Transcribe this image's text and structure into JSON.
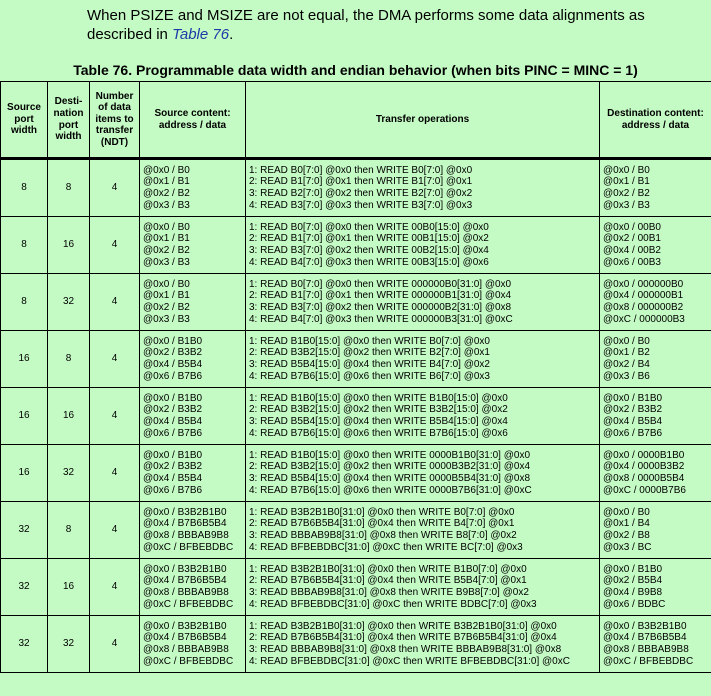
{
  "intro": {
    "text_before": "When PSIZE and MSIZE are not equal, the DMA performs some data alignments as described in ",
    "link": "Table 76",
    "text_after": "."
  },
  "table": {
    "caption": "Table 76. Programmable data width and endian behavior (when bits PINC = MINC = 1)",
    "headers": {
      "source_port": "Source port width",
      "dest_port": "Desti-nation port width",
      "ndt": "Number of data items to transfer (NDT)",
      "source_content": "Source content: address / data",
      "transfer": "Transfer operations",
      "dest_content": "Destination content: address / data"
    },
    "rows": [
      {
        "src_width": "8",
        "dst_width": "8",
        "ndt": "4",
        "src_content": "@0x0 / B0\n@0x1 / B1\n@0x2 / B2\n@0x3 / B3",
        "ops": "1: READ B0[7:0] @0x0 then WRITE B0[7:0] @0x0\n2: READ B1[7:0] @0x1 then WRITE B1[7:0] @0x1\n3: READ B2[7:0] @0x2 then WRITE B2[7:0] @0x2\n4: READ B3[7:0] @0x3 then WRITE B3[7:0] @0x3",
        "dst_content": "@0x0 / B0\n@0x1 / B1\n@0x2 / B2\n@0x3 / B3"
      },
      {
        "src_width": "8",
        "dst_width": "16",
        "ndt": "4",
        "src_content": "@0x0 / B0\n@0x1 / B1\n@0x2 / B2\n@0x3 / B3",
        "ops": "1: READ B0[7:0] @0x0 then WRITE 00B0[15:0] @0x0\n2: READ B1[7:0] @0x1 then WRITE 00B1[15:0] @0x2\n3: READ B3[7:0] @0x2 then WRITE 00B2[15:0] @0x4\n4: READ B4[7:0] @0x3 then WRITE 00B3[15:0] @0x6",
        "dst_content": "@0x0 / 00B0\n@0x2 / 00B1\n@0x4 / 00B2\n@0x6 / 00B3"
      },
      {
        "src_width": "8",
        "dst_width": "32",
        "ndt": "4",
        "src_content": "@0x0 / B0\n@0x1 / B1\n@0x2 / B2\n@0x3 / B3",
        "ops": "1: READ B0[7:0] @0x0 then WRITE 000000B0[31:0] @0x0\n2: READ B1[7:0] @0x1 then WRITE 000000B1[31:0] @0x4\n3: READ B3[7:0] @0x2 then WRITE 000000B2[31:0] @0x8\n4: READ B4[7:0] @0x3 then WRITE 000000B3[31:0] @0xC",
        "dst_content": "@0x0 / 000000B0\n@0x4 / 000000B1\n@0x8 / 000000B2\n@0xC / 000000B3"
      },
      {
        "src_width": "16",
        "dst_width": "8",
        "ndt": "4",
        "src_content": "@0x0 / B1B0\n@0x2 / B3B2\n@0x4 / B5B4\n@0x6 / B7B6",
        "ops": "1: READ B1B0[15:0] @0x0 then WRITE B0[7:0] @0x0\n2: READ B3B2[15:0] @0x2 then WRITE B2[7:0] @0x1\n3: READ B5B4[15:0] @0x4 then WRITE B4[7:0] @0x2\n4: READ B7B6[15:0] @0x6 then WRITE B6[7:0] @0x3",
        "dst_content": "@0x0 / B0\n@0x1 / B2\n@0x2 / B4\n@0x3 / B6"
      },
      {
        "src_width": "16",
        "dst_width": "16",
        "ndt": "4",
        "src_content": "@0x0 / B1B0\n@0x2 / B3B2\n@0x4 / B5B4\n@0x6 / B7B6",
        "ops": "1: READ B1B0[15:0] @0x0 then WRITE B1B0[15:0] @0x0\n2: READ B3B2[15:0] @0x2 then WRITE B3B2[15:0] @0x2\n3: READ B5B4[15:0] @0x4 then WRITE B5B4[15:0] @0x4\n4: READ B7B6[15:0] @0x6 then WRITE B7B6[15:0] @0x6",
        "dst_content": "@0x0 / B1B0\n@0x2 / B3B2\n@0x4 / B5B4\n@0x6 / B7B6"
      },
      {
        "src_width": "16",
        "dst_width": "32",
        "ndt": "4",
        "src_content": "@0x0 / B1B0\n@0x2 / B3B2\n@0x4 / B5B4\n@0x6 / B7B6",
        "ops": "1: READ B1B0[15:0] @0x0 then WRITE 0000B1B0[31:0] @0x0\n2: READ B3B2[15:0] @0x2 then WRITE 0000B3B2[31:0] @0x4\n3: READ B5B4[15:0] @0x4 then WRITE 0000B5B4[31:0] @0x8\n4: READ B7B6[15:0] @0x6 then WRITE 0000B7B6[31:0] @0xC",
        "dst_content": "@0x0 / 0000B1B0\n@0x4 / 0000B3B2\n@0x8 / 0000B5B4\n@0xC / 0000B7B6"
      },
      {
        "src_width": "32",
        "dst_width": "8",
        "ndt": "4",
        "src_content": "@0x0 / B3B2B1B0\n@0x4 / B7B6B5B4\n@0x8 / BBBAB9B8\n@0xC / BFBEBDBC",
        "ops": "1: READ B3B2B1B0[31:0] @0x0 then WRITE B0[7:0] @0x0\n2: READ B7B6B5B4[31:0] @0x4 then WRITE B4[7:0] @0x1\n3: READ BBBAB9B8[31:0] @0x8 then WRITE B8[7:0] @0x2\n4: READ BFBEBDBC[31:0] @0xC then WRITE BC[7:0] @0x3",
        "dst_content": "@0x0 / B0\n@0x1 / B4\n@0x2 / B8\n@0x3 / BC"
      },
      {
        "src_width": "32",
        "dst_width": "16",
        "ndt": "4",
        "src_content": "@0x0 / B3B2B1B0\n@0x4 / B7B6B5B4\n@0x8 / BBBAB9B8\n@0xC / BFBEBDBC",
        "ops": "1: READ B3B2B1B0[31:0] @0x0 then WRITE B1B0[7:0] @0x0\n2: READ B7B6B5B4[31:0] @0x4 then WRITE B5B4[7:0] @0x1\n3: READ BBBAB9B8[31:0] @0x8 then WRITE B9B8[7:0] @0x2\n4: READ BFBEBDBC[31:0] @0xC then WRITE BDBC[7:0] @0x3",
        "dst_content": "@0x0 / B1B0\n@0x2 / B5B4\n@0x4 / B9B8\n@0x6 / BDBC"
      },
      {
        "src_width": "32",
        "dst_width": "32",
        "ndt": "4",
        "src_content": "@0x0 / B3B2B1B0\n@0x4 / B7B6B5B4\n@0x8 / BBBAB9B8\n@0xC / BFBEBDBC",
        "ops": "1: READ B3B2B1B0[31:0] @0x0 then WRITE B3B2B1B0[31:0] @0x0\n2: READ B7B6B5B4[31:0] @0x4 then WRITE B7B6B5B4[31:0] @0x4\n3: READ BBBAB9B8[31:0] @0x8 then WRITE BBBAB9B8[31:0] @0x8\n4: READ BFBEBDBC[31:0] @0xC then WRITE BFBEBDBC[31:0] @0xC",
        "dst_content": "@0x0 / B3B2B1B0\n@0x4 / B7B6B5B4\n@0x8 / BBBAB9B8\n@0xC / BFBEBDBC"
      }
    ]
  }
}
